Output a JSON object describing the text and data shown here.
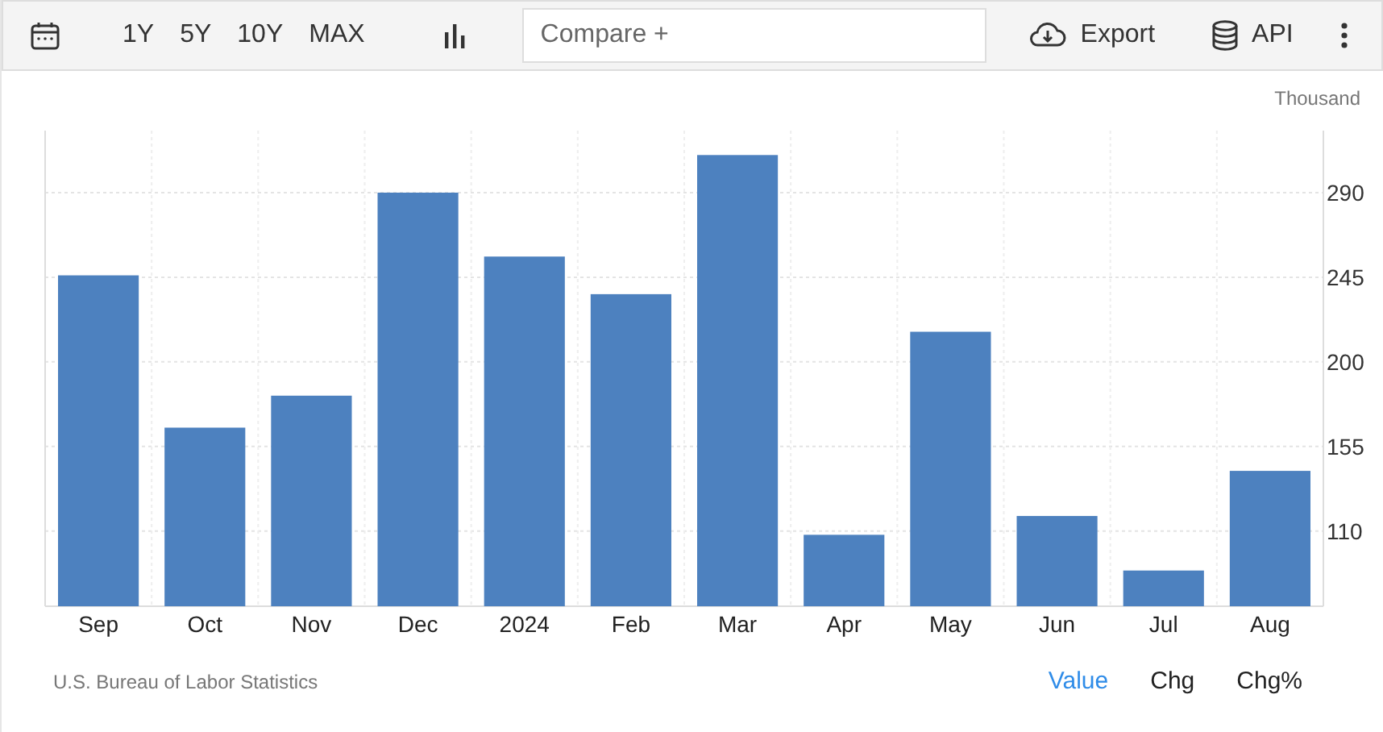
{
  "toolbar": {
    "ranges": [
      "1Y",
      "5Y",
      "10Y",
      "MAX"
    ],
    "compare": {
      "placeholder": "Compare +"
    },
    "export": "Export",
    "api": "API"
  },
  "chart": {
    "unit": "Thousand",
    "chart_data": {
      "type": "bar",
      "categories": [
        "Sep",
        "Oct",
        "Nov",
        "Dec",
        "2024",
        "Feb",
        "Mar",
        "Apr",
        "May",
        "Jun",
        "Jul",
        "Aug"
      ],
      "grid": true,
      "series": [
        {
          "color": "#4d81bf",
          "values": [
            246,
            165,
            182,
            290,
            256,
            236,
            310,
            108,
            216,
            118,
            89,
            142
          ]
        }
      ],
      "ylim": [
        70,
        323
      ],
      "yticks": [
        110,
        155,
        200,
        245,
        290
      ]
    }
  },
  "footer": {
    "source": "U.S. Bureau of Labor Statistics",
    "views": [
      {
        "label": "Value",
        "selected": true
      },
      {
        "label": "Chg",
        "selected": false
      },
      {
        "label": "Chg%",
        "selected": false
      }
    ]
  }
}
